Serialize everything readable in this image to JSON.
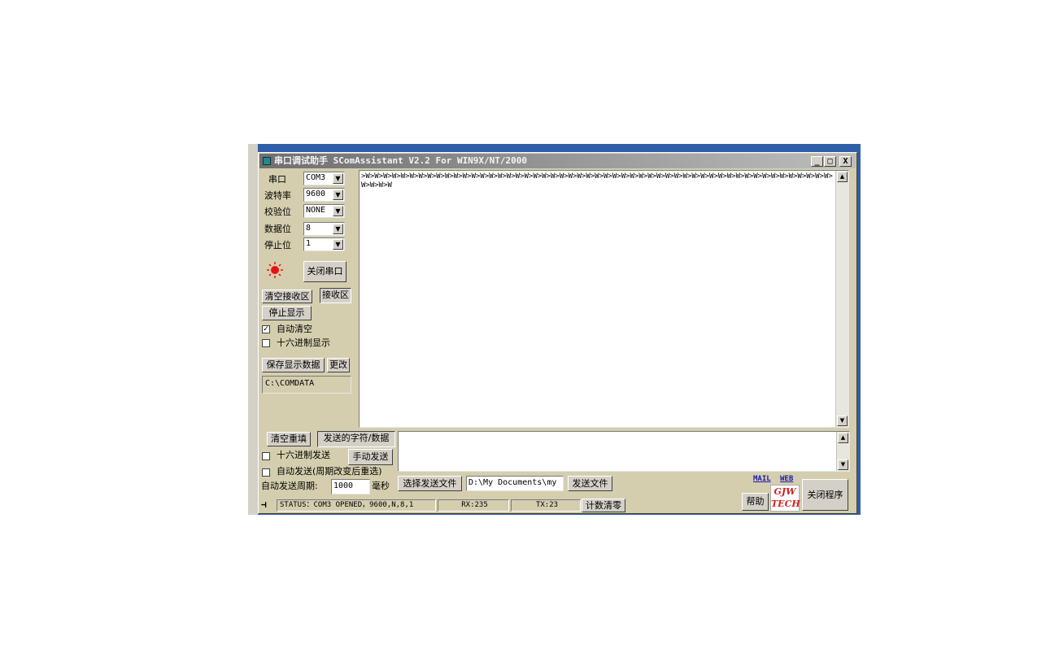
{
  "window": {
    "title": "串口调试助手 SComAssistant V2.2 For WIN9X/NT/2000",
    "minimize_glyph": "_",
    "maximize_glyph": "□",
    "close_glyph": "X"
  },
  "settings": {
    "port_label": "串口",
    "port_value": "COM3",
    "baud_label": "波特率",
    "baud_value": "9600",
    "parity_label": "校验位",
    "parity_value": "NONE",
    "databits_label": "数据位",
    "databits_value": "8",
    "stopbits_label": "停止位",
    "stopbits_value": "1",
    "combo_arrow": "▼"
  },
  "indicator": {
    "icon": "red-led-icon",
    "color": "#e81010"
  },
  "buttons": {
    "close_port": "关闭串口",
    "clear_receive": "清空接收区",
    "receive_area": "接收区",
    "stop_display": "停止显示",
    "save_data": "保存显示数据",
    "change": "更改",
    "clear_refill": "清空重填",
    "send_chars": "发送的字符/数据",
    "manual_send": "手动发送",
    "select_file": "选择发送文件",
    "send_file": "发送文件",
    "reset_count": "计数清零",
    "help": "帮助",
    "exit": "关闭程序"
  },
  "options": {
    "auto_clear": "自动清空",
    "auto_clear_checked": true,
    "hex_display": "十六进制显示",
    "hex_display_checked": false,
    "hex_send": "十六进制发送",
    "hex_send_checked": false,
    "auto_send": "自动发送(周期改变后重选)",
    "auto_send_checked": false,
    "check_mark": "✓"
  },
  "save_path": "C:\\COMDATA",
  "receive_text": ">W>W>W>W>W>W>W>W>W>W>W>W>W>W>W>W>W>W>W>W>W>W>W>W>W>W>W>W>W>W>W>W>W>W>W>W>W>W>W>W>W>W>W>W>W>W>W>W>W>W>W>W>W>W>W>W>W",
  "send_text": "",
  "auto_period": {
    "label": "自动发送周期:",
    "value": "1000",
    "unit": "毫秒"
  },
  "file_path": "D:\\My Documents\\my",
  "links": {
    "mail": "MAIL",
    "web": "WEB"
  },
  "logo": {
    "line1": "GJW",
    "line2": "TECH",
    "color": "#d02020"
  },
  "statusbar": {
    "status": "STATUS：COM3 OPENED，9600,N,8,1",
    "rx": "RX:235",
    "tx": "TX:23"
  },
  "scroll_up": "▲",
  "scroll_down": "▼",
  "colors": {
    "window_bg": "#d4ceae",
    "desktop": "#2f5fa8"
  }
}
